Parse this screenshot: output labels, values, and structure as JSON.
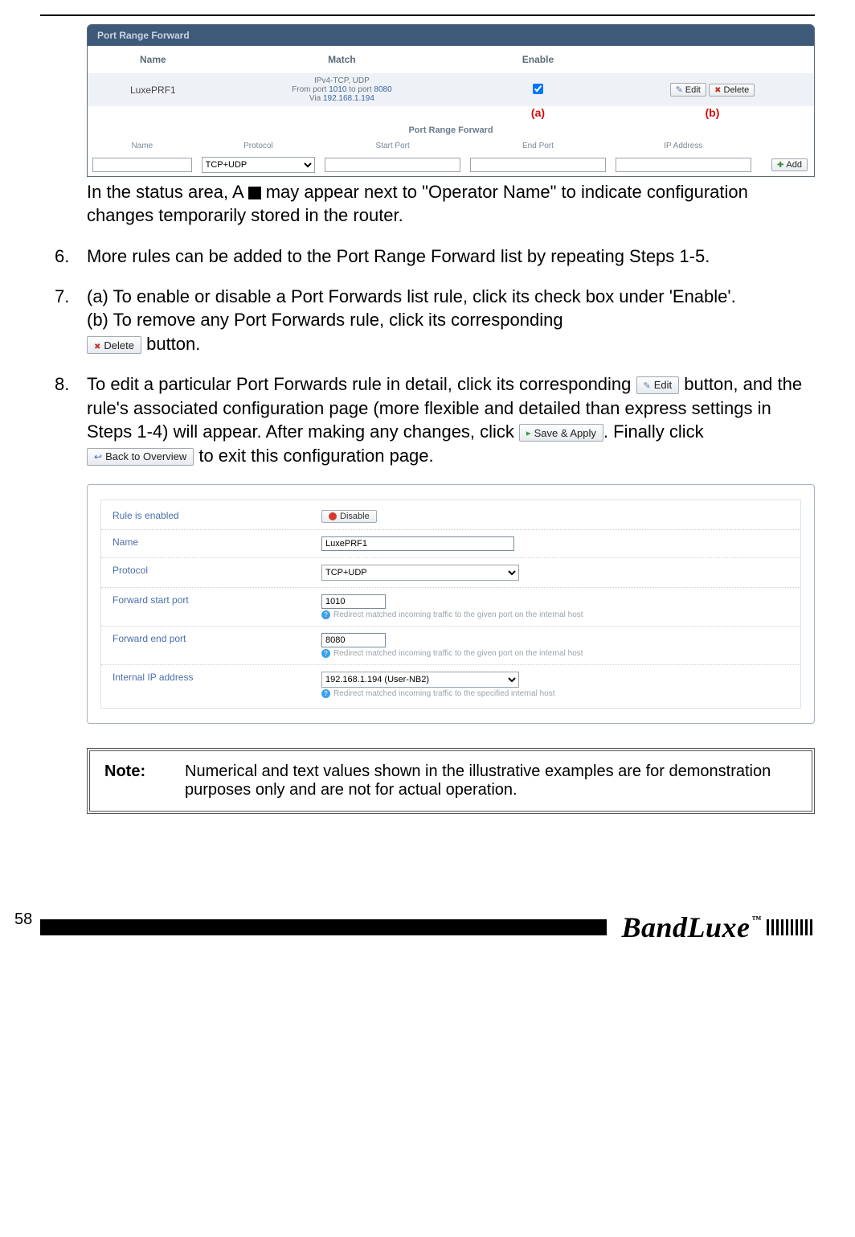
{
  "top_panel": {
    "title": "Port Range Forward",
    "headers": {
      "name": "Name",
      "match": "Match",
      "enable": "Enable"
    },
    "row": {
      "name": "LuxePRF1",
      "match_line1": "IPv4-TCP, UDP",
      "match_line2_pre": "From port ",
      "match_line2_p1": "1010",
      "match_line2_mid": " to port ",
      "match_line2_p2": "8080",
      "match_line3_pre": "Via ",
      "match_line3_ip": "192.168.1.194",
      "enable_checked": true,
      "edit_label": "Edit",
      "delete_label": "Delete"
    },
    "annot_a": "(a)",
    "annot_b": "(b)",
    "section2": {
      "title": "Port Range Forward",
      "labels": {
        "name": "Name",
        "protocol": "Protocol",
        "start": "Start Port",
        "end": "End Port",
        "ip": "IP Address"
      },
      "protocol_value": "TCP+UDP",
      "add_label": "Add"
    }
  },
  "status_text_1": "In the status area, A ",
  "status_text_2": " may appear next to \"Operator Name\" to indicate configuration changes temporarily stored in the router.",
  "li6": {
    "num": "6.",
    "text": "More rules can be added to the Port Range Forward list by repeating Steps 1-5."
  },
  "li7": {
    "num": "7.",
    "a": "(a) To enable or disable a Port Forwards list rule, click its check box under 'Enable'.",
    "b_pre": "(b) To remove any Port Forwards rule, click its corresponding ",
    "b_btn": "Delete",
    "b_post": " button."
  },
  "li8": {
    "num": "8.",
    "t1": "To edit a particular Port Forwards rule in detail, click its corresponding ",
    "edit_btn": "Edit",
    "t2": " button, and the rule's associated configuration page (more flexible and detailed than express settings in Steps 1-4) will appear. After making any changes, click ",
    "save_btn": "Save & Apply",
    "t3": ". Finally click ",
    "back_btn": "Back to Overview",
    "t4": " to exit this configuration page."
  },
  "detail_panel": {
    "rows": {
      "enabled": {
        "label": "Rule is enabled",
        "btn": "Disable"
      },
      "name": {
        "label": "Name",
        "value": "LuxePRF1"
      },
      "protocol": {
        "label": "Protocol",
        "value": "TCP+UDP"
      },
      "start": {
        "label": "Forward start port",
        "value": "1010",
        "hint": "Redirect matched incoming traffic to the given port on the internal host"
      },
      "end": {
        "label": "Forward end port",
        "value": "8080",
        "hint": "Redirect matched incoming traffic to the given port on the internal host"
      },
      "ip": {
        "label": "Internal IP address",
        "value": "192.168.1.194 (User-NB2)",
        "hint": "Redirect matched incoming traffic to the specified internal host"
      }
    }
  },
  "note": {
    "label": "Note:",
    "text": "Numerical and text values shown in the illustrative examples are for demonstration purposes only and are not for actual operation."
  },
  "page_number": "58",
  "brand": "BandLuxe",
  "tm": "™"
}
